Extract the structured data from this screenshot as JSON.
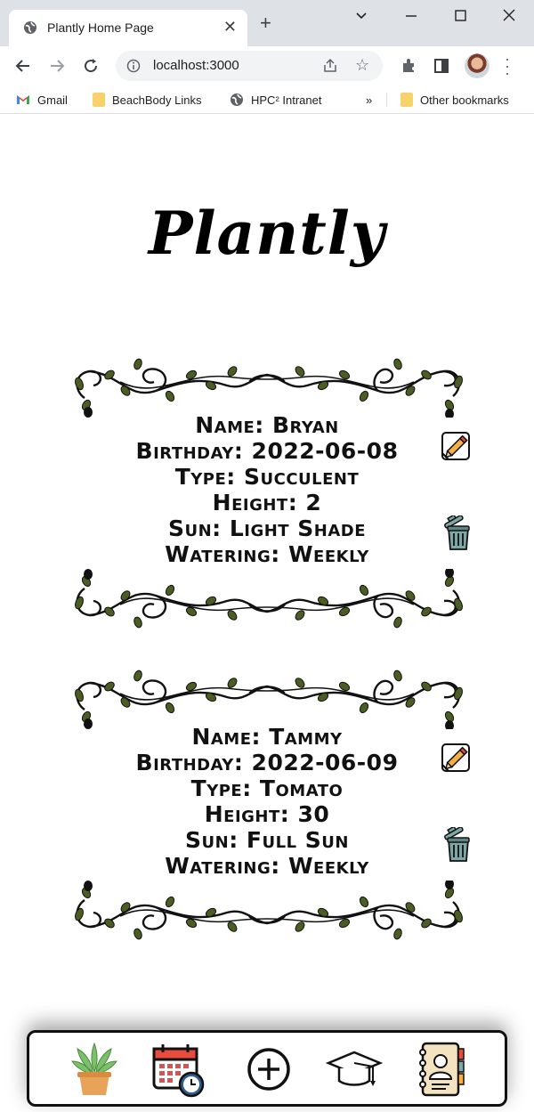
{
  "browser": {
    "tab_title": "Plantly Home Page",
    "url": "localhost:3000",
    "bookmarks": [
      {
        "label": "Gmail",
        "icon": "gmail-icon"
      },
      {
        "label": "BeachBody Links",
        "icon": "folder-icon"
      },
      {
        "label": "HPC² Intranet",
        "icon": "globe-icon"
      },
      {
        "label": "»",
        "icon": "overflow"
      },
      {
        "label": "Other bookmarks",
        "icon": "folder-icon"
      }
    ]
  },
  "app": {
    "title": "Plantly",
    "plants": [
      {
        "name": "Name: Bryan",
        "birthday": "Birthday: 2022-06-08",
        "type": "Type: Succulent",
        "height": "Height: 2",
        "sun": "Sun: Light Shade",
        "watering": "Watering: Weekly"
      },
      {
        "name": "Name: Tammy",
        "birthday": "Birthday: 2022-06-09",
        "type": "Type: Tomato",
        "height": "Height: 30",
        "sun": "Sun: Full Sun",
        "watering": "Watering: Weekly"
      }
    ],
    "nav_icons": [
      "plant-pot-icon",
      "calendar-clock-icon",
      "add-circle-icon",
      "graduation-cap-icon",
      "address-book-icon"
    ]
  },
  "colors": {
    "leaf": "#4a5d23",
    "vine": "#111111",
    "chrome_bg": "#dee1e6"
  }
}
